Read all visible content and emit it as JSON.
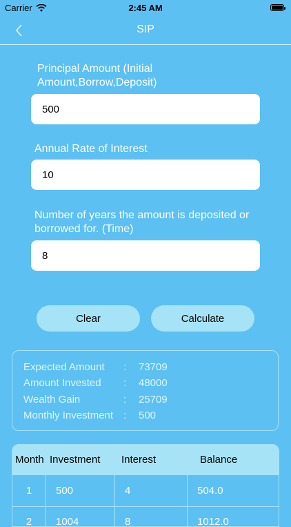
{
  "status": {
    "carrier": "Carrier",
    "time": "2:45 AM"
  },
  "nav": {
    "title": "SIP",
    "back_icon": "chevron-left-icon"
  },
  "form": {
    "principal_label": "Principal Amount (Initial Amount,Borrow,Deposit)",
    "principal_value": "500",
    "rate_label": "Annual Rate of Interest",
    "rate_value": "10",
    "years_label": "Number of years the amount is deposited or borrowed for. (Time)",
    "years_value": "8"
  },
  "buttons": {
    "clear": "Clear",
    "calculate": "Calculate"
  },
  "results": [
    {
      "label": "Expected Amount",
      "sep": ":",
      "value": "73709"
    },
    {
      "label": "Amount Invested",
      "sep": ":",
      "value": "48000"
    },
    {
      "label": "Wealth Gain",
      "sep": ":",
      "value": "25709"
    },
    {
      "label": "Monthly Investment",
      "sep": ":",
      "value": "500"
    }
  ],
  "table": {
    "headers": [
      "Month",
      "Investment",
      "Interest",
      "Balance"
    ],
    "rows": [
      [
        "1",
        "500",
        "4",
        "504.0"
      ],
      [
        "2",
        "1004",
        "8",
        "1012.0"
      ]
    ]
  },
  "colors": {
    "background": "#5cc0f2",
    "button": "#a7e3f7",
    "border": "#a9e3f7"
  }
}
